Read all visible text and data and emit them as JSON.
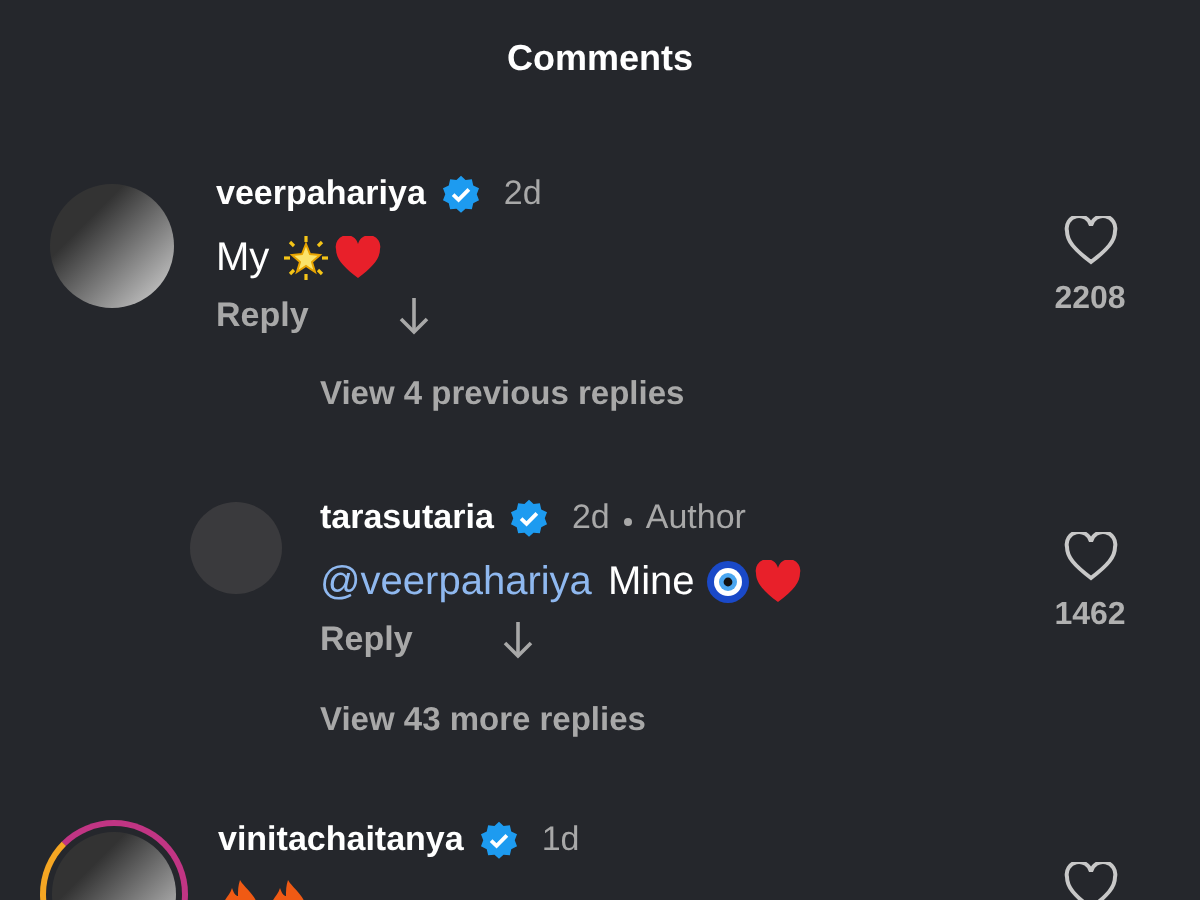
{
  "header": {
    "title": "Comments"
  },
  "items": [
    {
      "kind": "comment",
      "username": "veerpahariya",
      "verified": true,
      "time": "2d",
      "text": "My",
      "emoji": [
        {
          "kind": "sparkle"
        },
        {
          "kind": "heart"
        }
      ],
      "reply_label": "Reply",
      "likes": "2208",
      "liked": false
    },
    {
      "kind": "more",
      "label": "View 4 previous replies"
    },
    {
      "kind": "reply",
      "username": "tarasutaria",
      "verified": true,
      "time": "2d",
      "badge": "Author",
      "mention": "@veerpahariya",
      "text": "Mine",
      "emoji": [
        {
          "kind": "nazar"
        },
        {
          "kind": "heart"
        }
      ],
      "reply_label": "Reply",
      "likes": "1462",
      "liked": false
    },
    {
      "kind": "more",
      "label": "View 43 more replies"
    },
    {
      "kind": "comment",
      "username": "vinitachaitanya",
      "verified": true,
      "time": "1d",
      "story_ring": true,
      "emoji": [
        {
          "kind": "fire"
        },
        {
          "kind": "fire"
        }
      ],
      "liked": false
    }
  ]
}
